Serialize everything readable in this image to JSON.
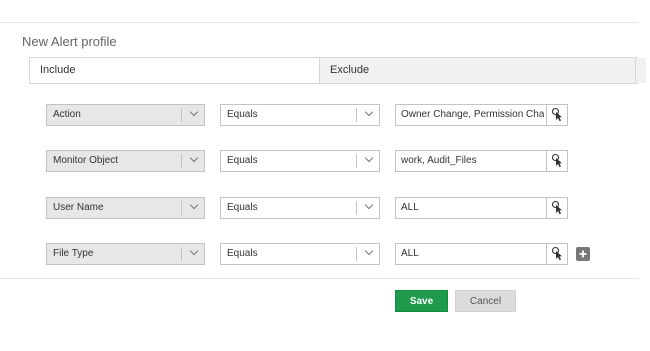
{
  "page": {
    "title": "New Alert profile"
  },
  "tabs": [
    {
      "label": "Include",
      "active": true
    },
    {
      "label": "Exclude",
      "active": false
    }
  ],
  "rows": [
    {
      "field": "Action",
      "operator": "Equals",
      "value": "Owner Change, Permission Change"
    },
    {
      "field": "Monitor Object",
      "operator": "Equals",
      "value": "work, Audit_Files"
    },
    {
      "field": "User Name",
      "operator": "Equals",
      "value": "ALL"
    },
    {
      "field": "File Type",
      "operator": "Equals",
      "value": "ALL"
    }
  ],
  "icons": {
    "dropdown": "chevron-down-icon",
    "picker": "pointer-icon",
    "add": "plus-icon"
  },
  "buttons": {
    "save_label": "Save",
    "cancel_label": "Cancel"
  },
  "colors": {
    "save_button": "#1d9a4c",
    "cancel_button": "#dcdcdc",
    "field_select_bg": "#e7e7e7",
    "add_button": "#787878"
  }
}
